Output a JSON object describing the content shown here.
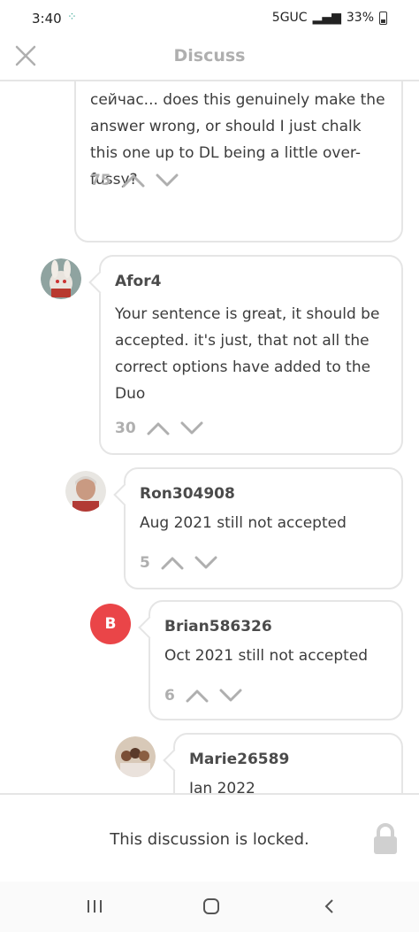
{
  "status_bar": {
    "time": "3:40",
    "network": "5GUC",
    "battery": "33%"
  },
  "header": {
    "title": "Discuss"
  },
  "comments": [
    {
      "body": "сейчас... does this genuinely make the answer wrong, or should I just chalk this one up to DL being a little over-fussy?",
      "votes": "75"
    },
    {
      "author": "Afor4",
      "body": "Your sentence is great, it should be accepted. it's just, that not all the correct options have added to the Duo",
      "votes": "30"
    },
    {
      "author": "Ron304908",
      "body": "Aug 2021 still not accepted",
      "votes": "5"
    },
    {
      "author": "Brian586326",
      "avatar_letter": "B",
      "body": "Oct 2021 still not accepted",
      "votes": "6"
    },
    {
      "author": "Marie26589",
      "body": "Jan 2022"
    }
  ],
  "locked_message": "This discussion is locked.",
  "colors": {
    "border": "#e5e5e5",
    "muted": "#afafaf",
    "avatar_b": "#ea4548"
  }
}
